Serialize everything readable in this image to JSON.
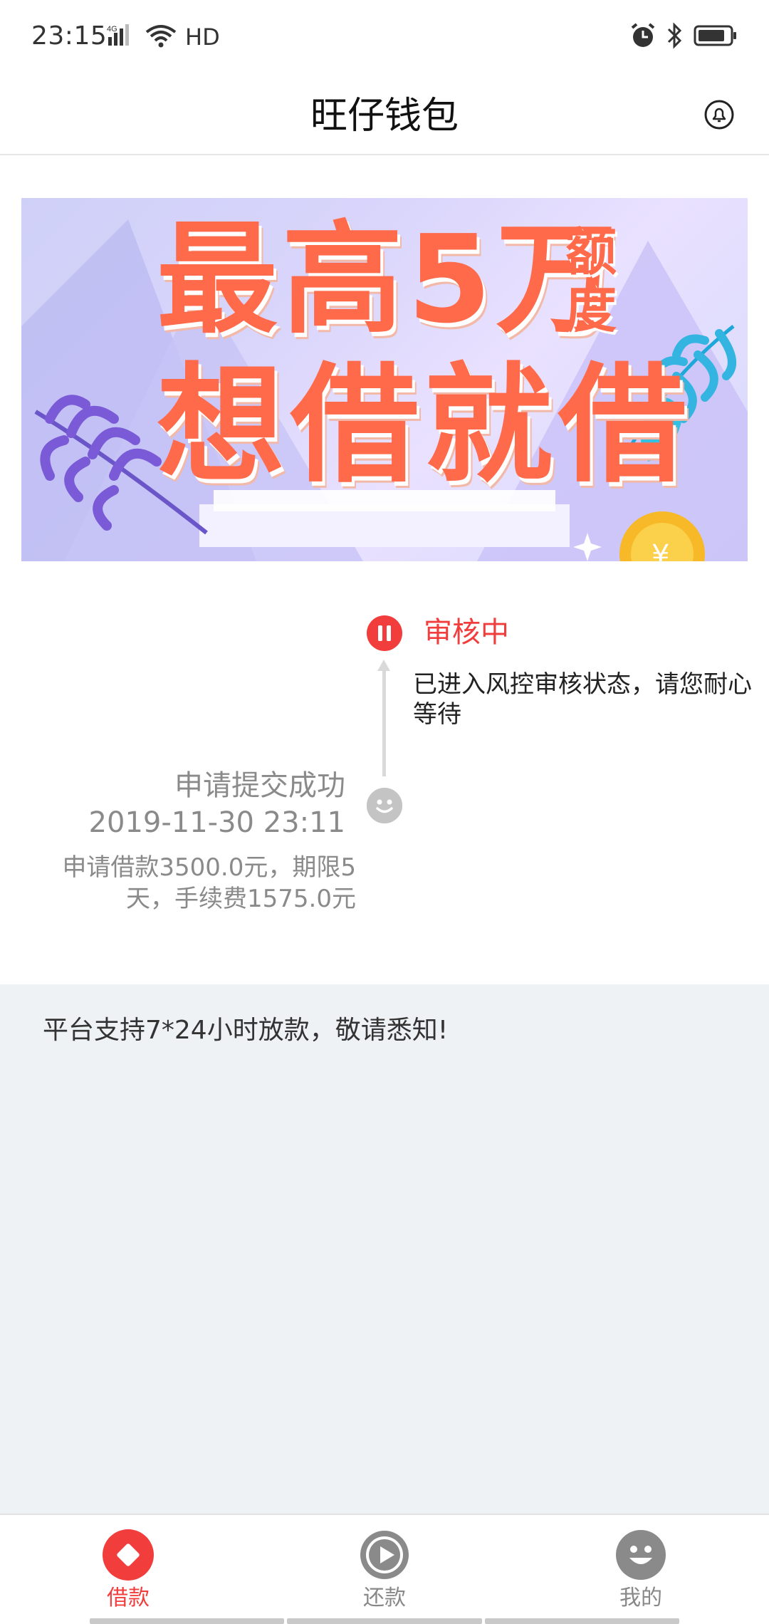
{
  "status_bar": {
    "time": "23:15",
    "network": "4G",
    "hd": "HD",
    "icons": [
      "signal-icon",
      "wifi-icon",
      "alarm-icon",
      "bluetooth-icon",
      "battery-icon"
    ]
  },
  "header": {
    "title": "旺仔钱包",
    "bell_icon": "bell-icon"
  },
  "banner": {
    "line1": "最高5万",
    "side_text": "额度",
    "line2": "想借就借"
  },
  "timeline": {
    "current": {
      "title": "审核中",
      "description": "已进入风控审核状态，请您耐心等待"
    },
    "submitted": {
      "title": "申请提交成功",
      "time": "2019-11-30 23:11",
      "description": "申请借款3500.0元，期限5天，手续费1575.0元"
    }
  },
  "notice": {
    "text": "平台支持7*24小时放款，敬请悉知!"
  },
  "bottom_nav": {
    "items": [
      {
        "label": "借款",
        "icon": "diamond-icon",
        "active": true
      },
      {
        "label": "还款",
        "icon": "play-icon",
        "active": false
      },
      {
        "label": "我的",
        "icon": "smiley-icon",
        "active": false
      }
    ]
  },
  "colors": {
    "accent": "#f23d3d",
    "inactive": "#888888",
    "background_gray": "#eff2f5"
  }
}
